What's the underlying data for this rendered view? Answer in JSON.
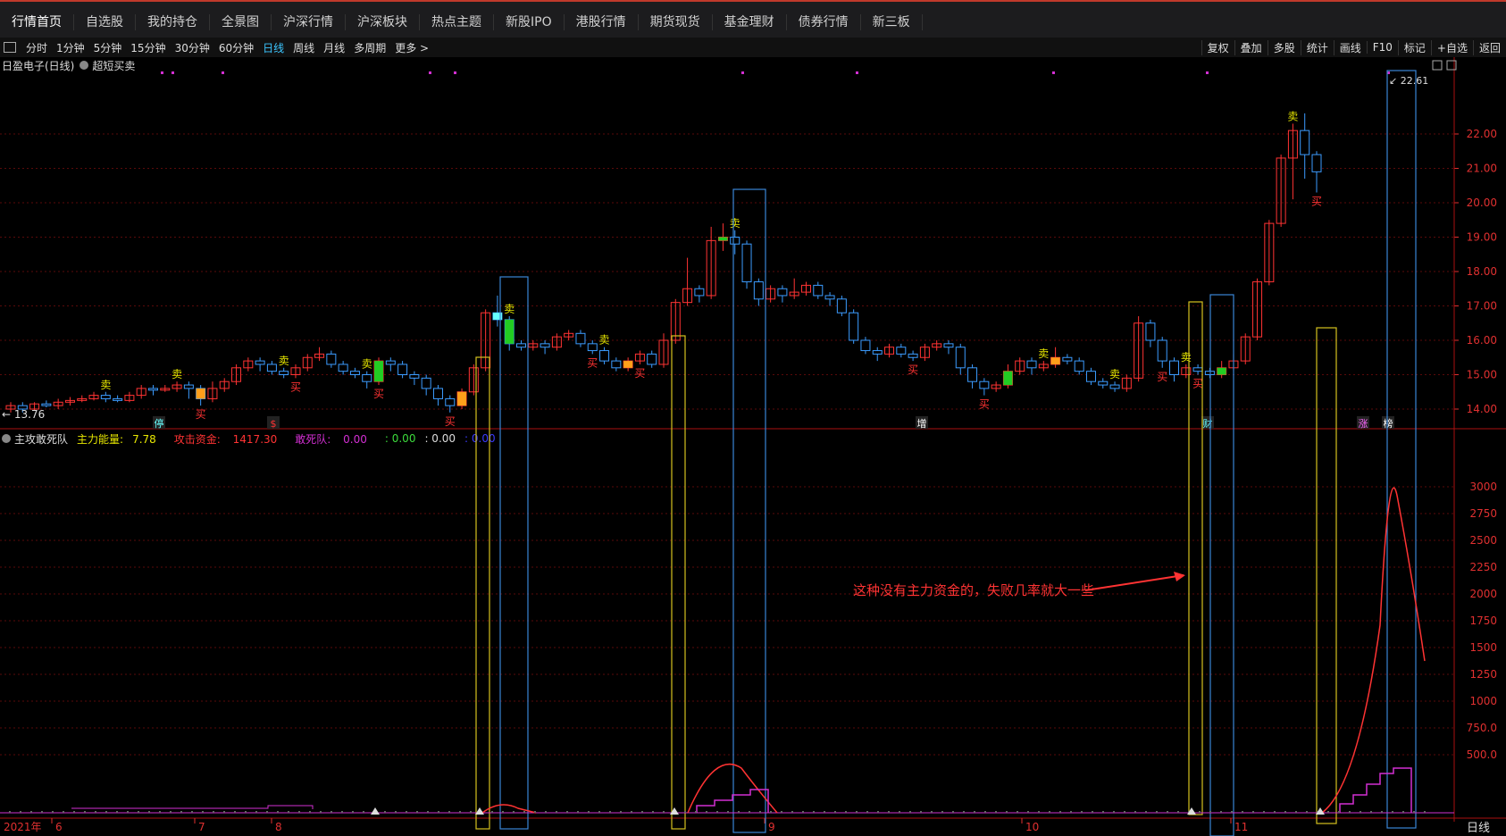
{
  "nav": {
    "items": [
      "行情首页",
      "自选股",
      "我的持仓",
      "全景图",
      "沪深行情",
      "沪深板块",
      "热点主题",
      "新股IPO",
      "港股行情",
      "期货现货",
      "基金理财",
      "债券行情",
      "新三板"
    ]
  },
  "periods": {
    "items": [
      "分时",
      "1分钟",
      "5分钟",
      "15分钟",
      "30分钟",
      "60分钟",
      "日线",
      "周线",
      "月线",
      "多周期",
      "更多 >"
    ],
    "active_index": 6
  },
  "tools": [
    "复权",
    "叠加",
    "多股",
    "统计",
    "画线",
    "F10",
    "标记",
    "+自选",
    "返回"
  ],
  "chart_title": {
    "stock": "日盈电子(日线)",
    "indicator": "超短买卖"
  },
  "indicator_bar": {
    "name": "主攻敢死队",
    "main_energy_label": "主力能量:",
    "main_energy_value": "7.78",
    "attack_label": "攻击资金:",
    "attack_value": "1417.30",
    "dare_label": "敢死队:",
    "dare_value": "0.00",
    "v4": ": 0.00",
    "v5": ": 0.00",
    "v6": ": 0.00"
  },
  "price_axis": [
    "22.00",
    "21.00",
    "20.00",
    "19.00",
    "18.00",
    "17.00",
    "16.00",
    "15.00",
    "14.00"
  ],
  "volume_axis": [
    "3000",
    "2750",
    "2500",
    "2250",
    "2000",
    "1750",
    "1500",
    "1250",
    "1000",
    "750.0",
    "500.0"
  ],
  "date_axis": [
    "2021年",
    "6",
    "7",
    "8",
    "9",
    "10",
    "11"
  ],
  "annotations": {
    "low_price": "13.76",
    "high_price": "22.61",
    "comment": "这种没有主力资金的，失败几率就大一些",
    "bottom_right": "日线",
    "events": [
      "停",
      "$",
      "增",
      "财",
      "涨",
      "榜"
    ]
  },
  "signals": {
    "sell": "卖",
    "buy": "买"
  },
  "colors": {
    "up": "#ff3333",
    "down": "#3c9cff",
    "ma_yellow": "#e8e800",
    "box_yellow": "#d4c21f",
    "box_blue": "#3a86d6",
    "magenta": "#d22fd2",
    "grid": "#5a0a0a"
  }
}
